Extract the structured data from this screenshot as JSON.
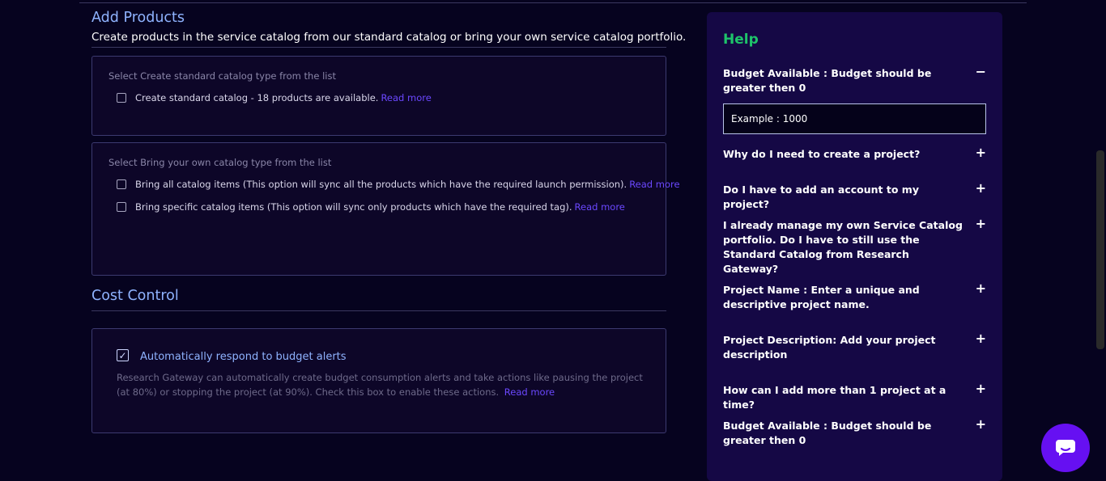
{
  "add_products": {
    "title": "Add Products",
    "subtitle": "Create products in the service catalog from our standard catalog or bring your own service catalog portfolio.",
    "standard": {
      "label": "Select Create standard catalog type from the list",
      "option": "Create standard catalog - 18 products are available.",
      "read_more": "Read more"
    },
    "byoc": {
      "label": "Select Bring your own catalog type from the list",
      "options": [
        {
          "text": "Bring all catalog items (This option will sync all the products which have the required launch permission).",
          "read_more": "Read more"
        },
        {
          "text": "Bring specific catalog items (This option will sync only products which have the required tag).",
          "read_more": "Read more"
        }
      ]
    }
  },
  "cost_control": {
    "title": "Cost Control",
    "checkbox_label": "Automatically respond to budget alerts",
    "checked_mark": "✓",
    "description": "Research Gateway can automatically create budget consumption alerts and take actions like pausing the project (at 80%) or stopping the project (at 90%). Check this box to enable these actions.",
    "read_more": "Read more"
  },
  "help": {
    "title": "Help",
    "expanded_sign": "−",
    "collapsed_sign": "+",
    "faqs": [
      {
        "question": "Budget Available : Budget should be greater then 0",
        "expanded": true,
        "answer": "Example : 1000"
      },
      {
        "question": "Why do I need to create a project?",
        "expanded": false
      },
      {
        "question": "Do I have to add an account to my project?",
        "expanded": false
      },
      {
        "question": "I already manage my own Service Catalog portfolio. Do I have to still use the Standard Catalog from Research Gateway?",
        "expanded": false
      },
      {
        "question": "Project Name : Enter a unique and descriptive project name.",
        "expanded": false
      },
      {
        "question": "Project Description: Add your project description",
        "expanded": false
      },
      {
        "question": "How can I add more than 1 project at a time?",
        "expanded": false
      },
      {
        "question": "Budget Available : Budget should be greater then 0",
        "expanded": false
      }
    ]
  },
  "colors": {
    "background": "#06031f",
    "accent_blue": "#8fb3ff",
    "link": "#6b48ff",
    "help_title": "#1ec46a",
    "chat_button": "#6610f2"
  },
  "chat": {
    "icon": "chat-bubble-icon"
  }
}
